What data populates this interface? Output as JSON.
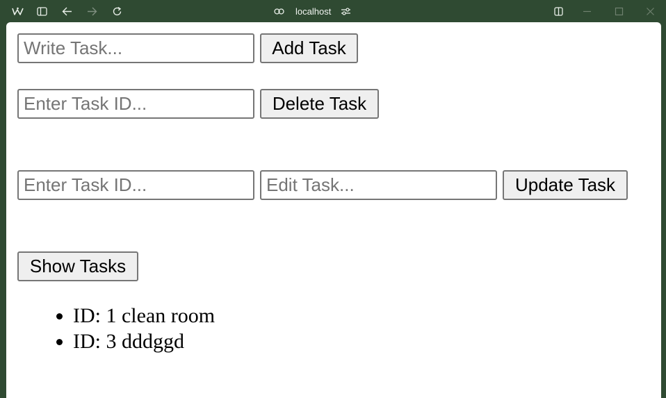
{
  "browser": {
    "url": "localhost",
    "icons": [
      "app-logo-icon",
      "sidebar-toggle-icon",
      "back-icon",
      "forward-icon",
      "reload-icon",
      "link-icon",
      "site-settings-icon",
      "split-view-icon",
      "minimize-icon",
      "maximize-icon",
      "close-icon"
    ]
  },
  "add_section": {
    "input_placeholder": "Write Task...",
    "input_value": "",
    "button_label": "Add Task"
  },
  "delete_section": {
    "input_placeholder": "Enter Task ID...",
    "input_value": "",
    "button_label": "Delete Task"
  },
  "update_section": {
    "id_placeholder": "Enter Task ID...",
    "id_value": "",
    "edit_placeholder": "Edit Task...",
    "edit_value": "",
    "button_label": "Update Task"
  },
  "show_section": {
    "button_label": "Show Tasks"
  },
  "tasks": [
    {
      "text": "ID: 1 clean room"
    },
    {
      "text": "ID: 3 dddggd"
    }
  ]
}
